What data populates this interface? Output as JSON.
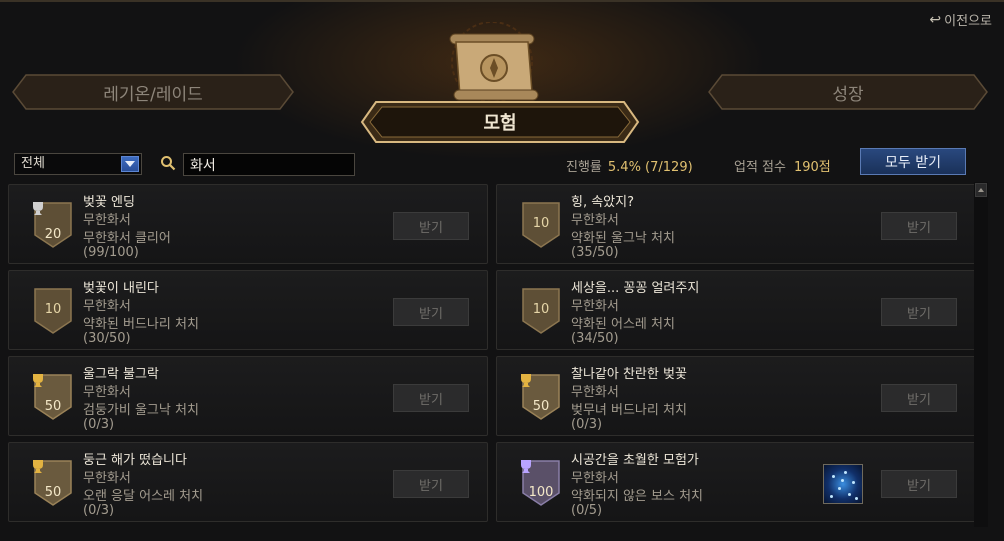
{
  "header": {
    "back_label": "이전으로",
    "tabs": [
      {
        "label": "레기온/레이드"
      },
      {
        "label": "모험"
      },
      {
        "label": "성장"
      }
    ]
  },
  "toolbar": {
    "filter_value": "전체",
    "search_value": "화서",
    "progress_label": "진행률",
    "progress_value": "5.4% (7/129)",
    "score_label": "업적 점수",
    "score_value": "190점",
    "claim_all_label": "모두 받기"
  },
  "achievements": [
    {
      "title": "벚꽃 엔딩",
      "category": "무한화서",
      "condition": "무한화서 클리어",
      "progress": "(99/100)",
      "points": "20",
      "tier": "silver",
      "claim_label": "받기"
    },
    {
      "title": "힝, 속았지?",
      "category": "무한화서",
      "condition": "약화된 울그낙 처치",
      "progress": "(35/50)",
      "points": "10",
      "tier": "none",
      "claim_label": "받기"
    },
    {
      "title": "벚꽃이 내린다",
      "category": "무한화서",
      "condition": "약화된 버드나리 처치",
      "progress": "(30/50)",
      "points": "10",
      "tier": "none",
      "claim_label": "받기"
    },
    {
      "title": "세상을... 꽁꽁 얼려주지",
      "category": "무한화서",
      "condition": "약화된 어스레 처치",
      "progress": "(34/50)",
      "points": "10",
      "tier": "none",
      "claim_label": "받기"
    },
    {
      "title": "울그락 불그락",
      "category": "무한화서",
      "condition": "검둥가비 울그낙 처치",
      "progress": "(0/3)",
      "points": "50",
      "tier": "gold",
      "claim_label": "받기"
    },
    {
      "title": "찰나같아 찬란한 벚꽃",
      "category": "무한화서",
      "condition": "벚무녀 버드나리 처치",
      "progress": "(0/3)",
      "points": "50",
      "tier": "gold",
      "claim_label": "받기"
    },
    {
      "title": "둥근 해가 떴습니다",
      "category": "무한화서",
      "condition": "오랜 응달 어스레 처치",
      "progress": "(0/3)",
      "points": "50",
      "tier": "gold",
      "claim_label": "받기"
    },
    {
      "title": "시공간을 초월한 모험가",
      "category": "무한화서",
      "condition": "약화되지 않은 보스 처치",
      "progress": "(0/5)",
      "points": "100",
      "tier": "purple",
      "claim_label": "받기",
      "reward_icon": "sparkle-item-icon"
    }
  ],
  "colors": {
    "gold": "#e3b341",
    "silver": "#cfcfcf",
    "purple": "#b9a4ff",
    "accent_blue": "#2a4f99",
    "badge_fill": "#6a5a3e"
  }
}
